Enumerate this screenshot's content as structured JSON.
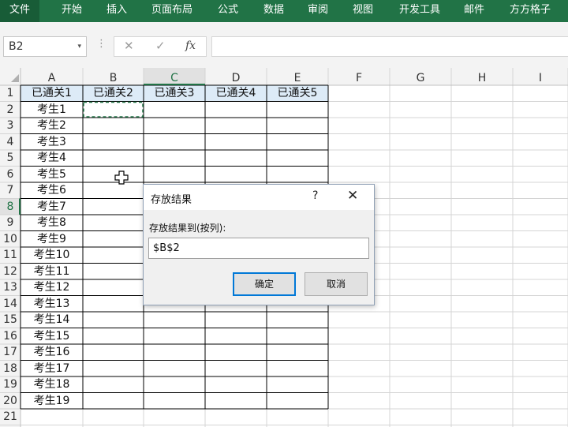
{
  "ribbon": {
    "tabs": [
      "文件",
      "开始",
      "插入",
      "页面布局",
      "公式",
      "数据",
      "审阅",
      "视图",
      "开发工具",
      "邮件",
      "方方格子"
    ]
  },
  "formula_bar": {
    "name_box": "B2",
    "dropdown_glyph": "▾",
    "dots_glyph": "⋮",
    "cancel_glyph": "✕",
    "enter_glyph": "✓",
    "fx_label": "fx",
    "content": ""
  },
  "sheet": {
    "columns": [
      "A",
      "B",
      "C",
      "D",
      "E",
      "F",
      "G",
      "H",
      "I"
    ],
    "selected_column": "C",
    "selected_row": 8,
    "active_cell": "B2",
    "headers": [
      "已通关1",
      "已通关2",
      "已通关3",
      "已通关4",
      "已通关5"
    ],
    "examinees": [
      "考生1",
      "考生2",
      "考生3",
      "考生4",
      "考生5",
      "考生6",
      "考生7",
      "考生8",
      "考生9",
      "考生10",
      "考生11",
      "考生12",
      "考生13",
      "考生14",
      "考生15",
      "考生16",
      "考生17",
      "考生18",
      "考生19"
    ],
    "row_numbers": [
      "1",
      "2",
      "3",
      "4",
      "5",
      "6",
      "7",
      "8",
      "9",
      "10",
      "11",
      "12",
      "13",
      "14",
      "15",
      "16",
      "17",
      "18",
      "19",
      "20",
      "21"
    ]
  },
  "dialog": {
    "title": "存放结果",
    "help": "?",
    "close": "✕",
    "label": "存放结果到(按列):",
    "value": "$B$2",
    "ok_label": "确定",
    "cancel_label": "取消"
  },
  "colors": {
    "ribbon": "#217346",
    "grid_line": "#d4d4d4",
    "border_line": "#000000",
    "header_bg": "#ddebf7",
    "selection": "#217346"
  }
}
